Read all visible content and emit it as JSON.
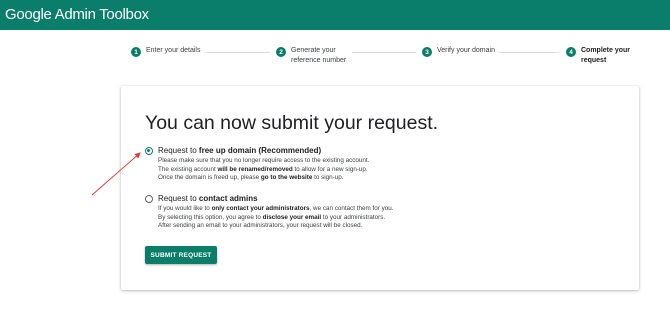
{
  "app": {
    "title": "Google Admin Toolbox"
  },
  "steps": [
    {
      "number": "1",
      "label": "Enter your details"
    },
    {
      "number": "2",
      "label": "Generate your\nreference number"
    },
    {
      "number": "3",
      "label": "Verify your domain"
    },
    {
      "number": "4",
      "label": "Complete your\nrequest"
    }
  ],
  "card": {
    "heading": "You can now submit your request.",
    "options": [
      {
        "title_prefix": "Request to ",
        "title_bold": "free up domain (Recommended)",
        "selected": true,
        "line1": "Please make sure that you no longer require access to the existing account.",
        "line2_a": "The existing account ",
        "line2_b": "will be renamed/removed",
        "line2_c": " to allow for a new sign-up.",
        "line3_a": "Once the domain is freed up, please ",
        "line3_b": "go to the website",
        "line3_c": " to sign-up."
      },
      {
        "title_prefix": "Request to ",
        "title_bold": "contact admins",
        "selected": false,
        "line1_a": "If you would like to ",
        "line1_b": "only contact your administrators",
        "line1_c": ", we can contact them for you.",
        "line2_a": "By selecting this option, you agree to ",
        "line2_b": "disclose your email",
        "line2_c": " to your administrators.",
        "line3": "After sending an email to your administrators, your request will be closed."
      }
    ],
    "submit_label": "SUBMIT REQUEST"
  },
  "colors": {
    "brand": "#0b7d6b",
    "annotation_arrow": "#e53935"
  },
  "icons": {
    "annotation": "red-arrow-icon",
    "selected_radio": "radio-checked-icon",
    "unselected_radio": "radio-unchecked-icon"
  }
}
